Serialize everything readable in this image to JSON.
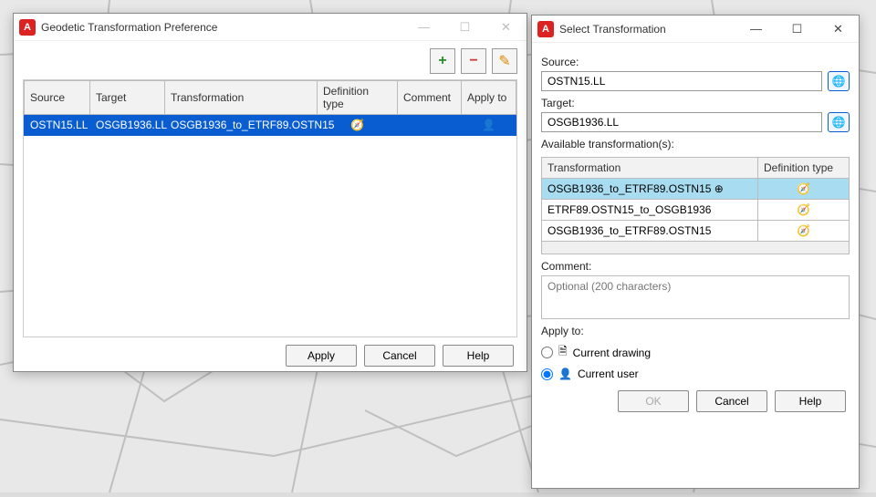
{
  "pref_window": {
    "title": "Geodetic Transformation Preference",
    "toolbar": {
      "add": "+",
      "remove": "−",
      "edit": "✎"
    },
    "columns": [
      "Source",
      "Target",
      "Transformation",
      "Definition type",
      "Comment",
      "Apply to"
    ],
    "rows": [
      {
        "source": "OSTN15.LL",
        "target": "OSGB1936.LL",
        "transformation": "OSGB1936_to_ETRF89.OSTN15",
        "def_icon": "🧭",
        "comment": "",
        "apply_icon": "👤"
      }
    ],
    "buttons": {
      "apply": "Apply",
      "cancel": "Cancel",
      "help": "Help"
    }
  },
  "select_window": {
    "title": "Select Transformation",
    "source_label": "Source:",
    "source_value": "OSTN15.LL",
    "target_label": "Target:",
    "target_value": "OSGB1936.LL",
    "available_label": "Available transformation(s):",
    "columns": [
      "Transformation",
      "Definition type"
    ],
    "rows": [
      {
        "name": "OSGB1936_to_ETRF89.OSTN15",
        "flag": "⊕",
        "icon": "🧭",
        "selected": true
      },
      {
        "name": "ETRF89.OSTN15_to_OSGB1936",
        "flag": "",
        "icon": "🧭",
        "selected": false
      },
      {
        "name": "OSGB1936_to_ETRF89.OSTN15",
        "flag": "",
        "icon": "🧭",
        "selected": false
      }
    ],
    "comment_label": "Comment:",
    "comment_placeholder": "Optional (200 characters)",
    "apply_to_label": "Apply to:",
    "apply_options": {
      "drawing": "Current drawing",
      "user": "Current user"
    },
    "apply_selected": "user",
    "buttons": {
      "ok": "OK",
      "cancel": "Cancel",
      "help": "Help"
    }
  }
}
